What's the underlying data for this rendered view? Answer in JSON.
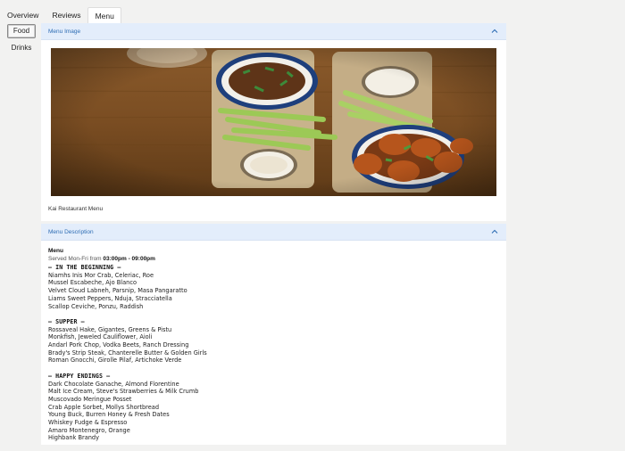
{
  "tabs": [
    "Overview",
    "Reviews",
    "Menu"
  ],
  "side": {
    "food": "Food",
    "drinks": "Drinks"
  },
  "image_panel": {
    "title": "Menu Image",
    "caption": "Kai Restaurant Menu",
    "photo_icon": "food-photo"
  },
  "desc_panel": {
    "title": "Menu Description",
    "heading": "Menu",
    "served_prefix": "Served Mon-Fri from ",
    "served_hours": "03:00pm - 09:00pm"
  },
  "sections": [
    {
      "title": "— IN THE BEGINNING —",
      "items": [
        "Niamhs Inis Mor Crab, Celeriac, Roe",
        "Mussel Escabeche, Ajo Blanco",
        "Velvet Cloud Labneh, Parsnip, Masa Pangaratto",
        "Liams Sweet Peppers, Nduja, Stracciatella",
        "Scallop Ceviche, Ponzu, Raddish"
      ]
    },
    {
      "title": "— SUPPER —",
      "items": [
        "Rossaveal Hake, Gigantes, Greens & Pistu",
        "Monkfish, Jeweled Cauliflower, Aioli",
        "Andarl Pork Chop, Vodka Beets, Ranch Dressing",
        "Brady's Strip Steak, Chanterelle Butter & Golden Girls",
        "Roman Gnocchi, Girolle Pilaf, Artichoke Verde"
      ]
    },
    {
      "title": "— HAPPY ENDINGS —",
      "items": [
        "Dark Chocolate Ganache, Almond Florentine",
        "Malt Ice Cream, Steve's Strawberries & Milk Crumb",
        "Muscovado Meringue Posset",
        "Crab Apple Sorbet, Mollys Shortbread",
        "Young Buck, Burren Honey & Fresh Dates",
        "Whiskey Fudge & Espresso",
        "Amaro Montenegro, Orange",
        "Highbank Brandy"
      ]
    }
  ]
}
